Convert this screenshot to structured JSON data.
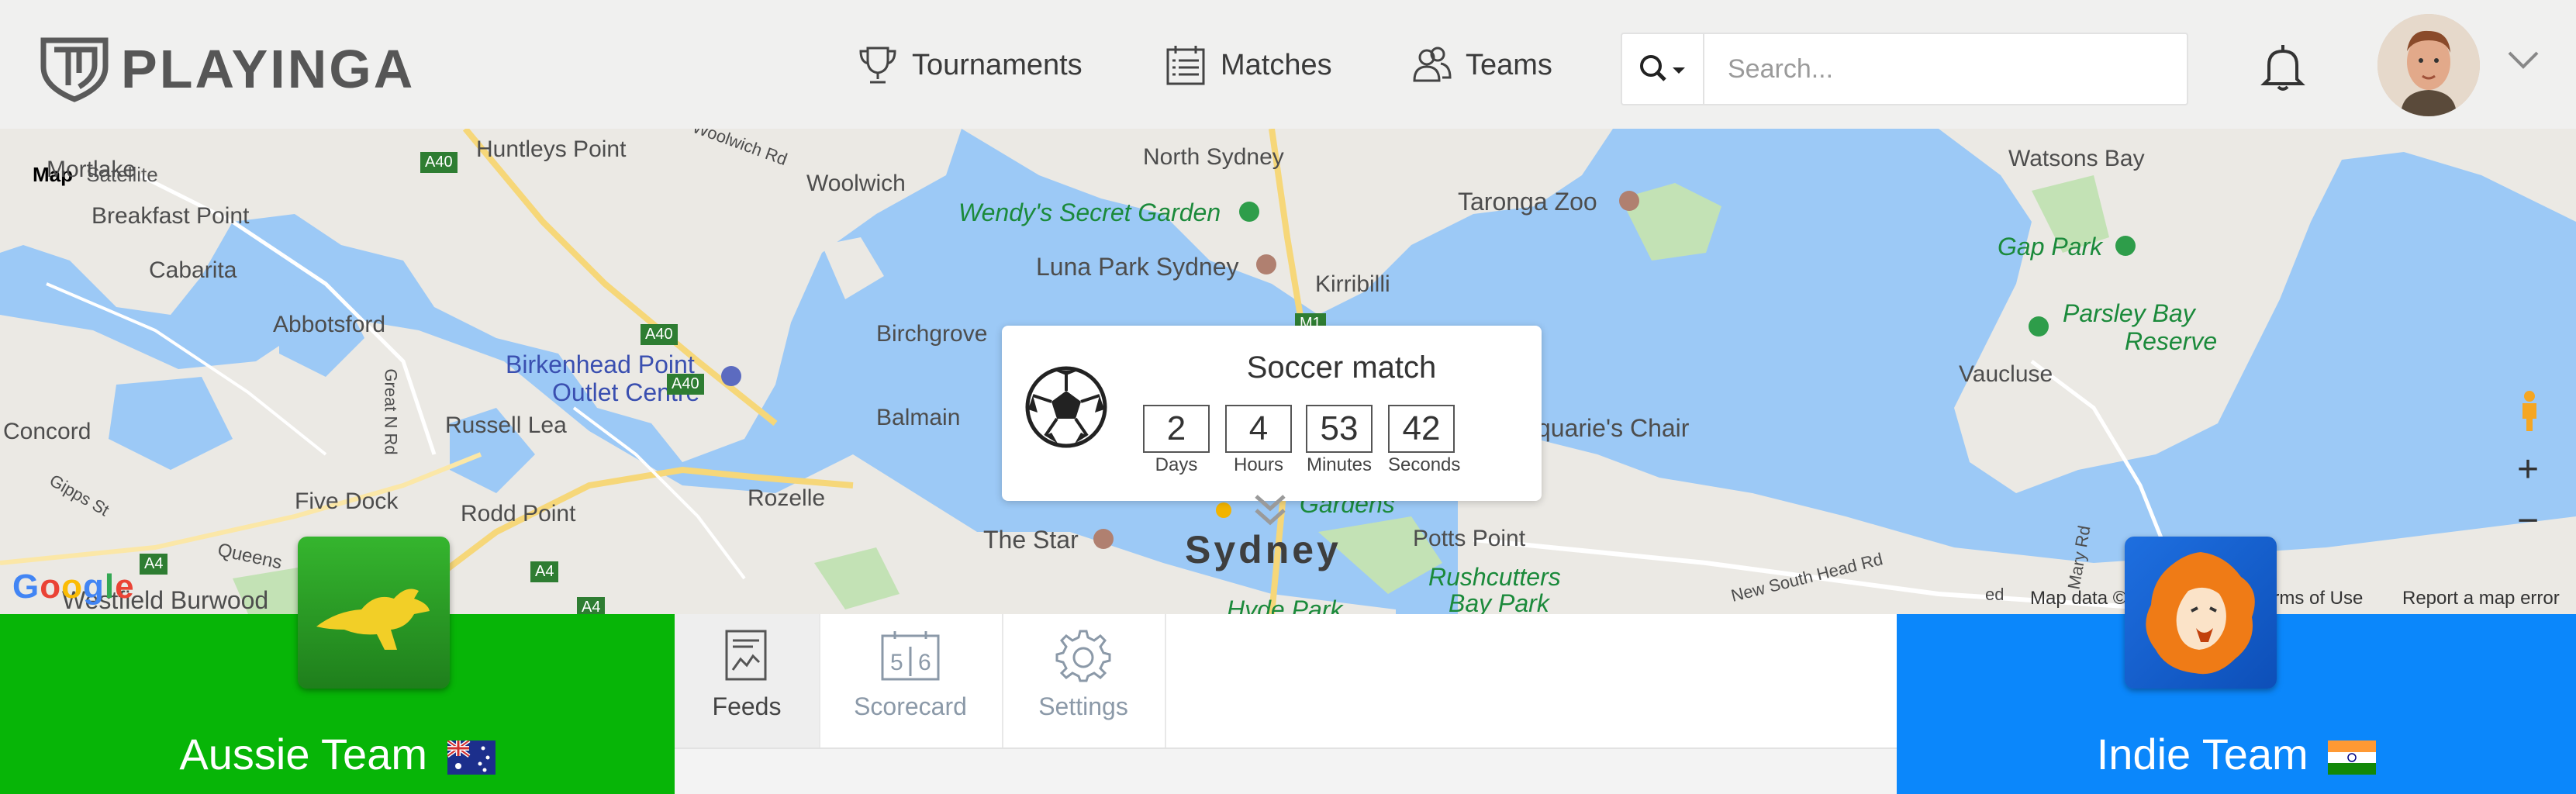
{
  "brand": {
    "logo_text": "PLAYINGA"
  },
  "nav": {
    "tournaments": "Tournaments",
    "matches": "Matches",
    "teams": "Teams"
  },
  "search": {
    "placeholder": "Search..."
  },
  "map": {
    "map_type": {
      "map": "Map",
      "satellite": "Satellite"
    },
    "places": {
      "mortlake": "Mortlake",
      "huntleys_point": "Huntleys Point",
      "woolwich_rd": "Woolwich Rd",
      "woolwich": "Woolwich",
      "north_sydney": "North Sydney",
      "watsons_bay": "Watsons Bay",
      "breakfast_point": "Breakfast Point",
      "wendys": "Wendy's Secret Garden",
      "taronga": "Taronga Zoo",
      "cabarita": "Cabarita",
      "gap_park": "Gap Park",
      "luna_park": "Luna Park Sydney",
      "kirribilli": "Kirribilli",
      "abbotsford": "Abbotsford",
      "parsley_bay": "Parsley Bay",
      "reserve": "Reserve",
      "birkenhead1": "Birkenhead Point",
      "birkenhead2": "Outlet Centre",
      "birchgrove": "Birchgrove",
      "vaucluse": "Vaucluse",
      "great_n_rd": "Great N Rd",
      "concord": "Concord",
      "russell_lea": "Russell Lea",
      "balmain": "Balmain",
      "macquaries_chair": "quarie's Chair",
      "gipps_st": "Gipps St",
      "five_dock": "Five Dock",
      "rozelle": "Rozelle",
      "rodd_point": "Rodd Point",
      "gardens": "Gardens",
      "the_star": "The Star",
      "sydney": "Sydney",
      "potts_point": "Potts Point",
      "queens": "Queens",
      "rushcutters1": "Rushcutters",
      "rushcutters2": "Bay Park",
      "westfield": "Westfield Burwood",
      "hyde_park": "Hyde Park",
      "new_south_head": "New South Head Rd",
      "ed": "ed",
      "mary_rd": "Mary Rd"
    },
    "road_shields": {
      "a40a": "A40",
      "a40b": "A40",
      "a40c": "A40",
      "a4a": "A4",
      "a4b": "A4",
      "a4c": "A4",
      "m1": "M1"
    },
    "zoom_in": "+",
    "zoom_out": "−",
    "attribution": {
      "map_data": "Map data ©",
      "terms": "erms of Use",
      "report": "Report a map error"
    },
    "google": "Google"
  },
  "match_card": {
    "title": "Soccer match",
    "countdown": [
      {
        "value": "2",
        "label": "Days"
      },
      {
        "value": "4",
        "label": "Hours"
      },
      {
        "value": "53",
        "label": "Minutes"
      },
      {
        "value": "42",
        "label": "Seconds"
      }
    ]
  },
  "teams": {
    "home": {
      "name": "Aussie Team",
      "color": "#07b507"
    },
    "away": {
      "name": "Indie Team",
      "color": "#0b87fb"
    }
  },
  "tabs": {
    "feeds": "Feeds",
    "scorecard": "Scorecard",
    "settings": "Settings",
    "scorecard_icon_digits": {
      "a": "5",
      "b": "6"
    }
  },
  "icons": {
    "logo": "shield-logo-icon",
    "tournaments": "trophy-icon",
    "matches": "calendar-list-icon",
    "teams": "users-icon",
    "search": "search-icon",
    "notifications": "bell-icon",
    "profile_menu": "chevron-down-icon",
    "feeds": "chart-document-icon",
    "scorecard": "scoreboard-icon",
    "settings": "gear-icon"
  }
}
